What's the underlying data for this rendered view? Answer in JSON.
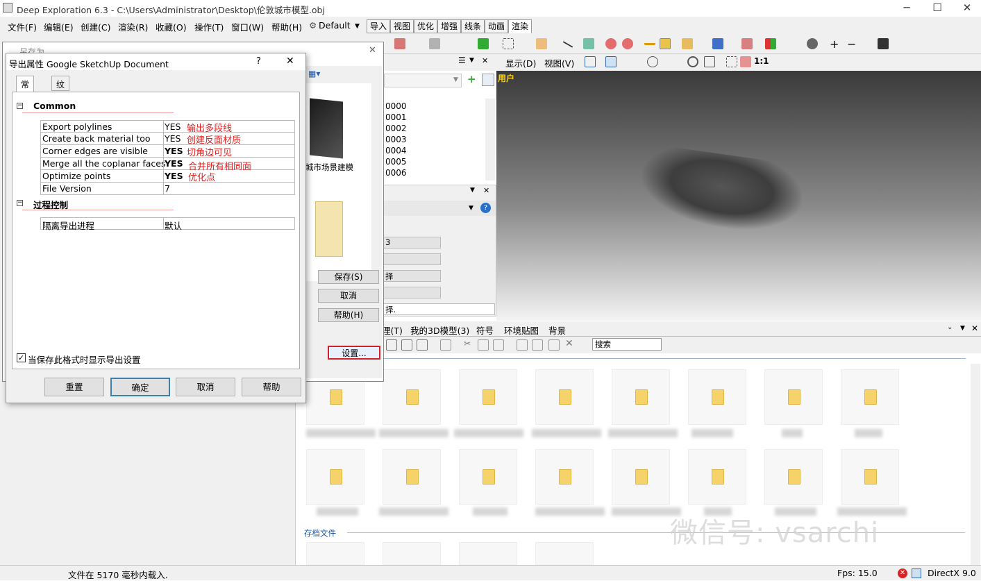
{
  "app": {
    "title": "Deep Exploration 6.3 - C:\\Users\\Administrator\\Desktop\\伦敦城市模型.obj"
  },
  "menu": [
    "文件(F)",
    "编辑(E)",
    "创建(C)",
    "渲染(R)",
    "收藏(O)",
    "操作(T)",
    "窗口(W)",
    "帮助(H)"
  ],
  "preset": "Default",
  "tabs": [
    "导入",
    "视图",
    "优化",
    "增强",
    "线条",
    "动画",
    "渲染"
  ],
  "active_tab": "渲染",
  "view_toolbar": {
    "display": "显示(D)",
    "view": "视图(V)",
    "ratio": "1:1"
  },
  "viewport": {
    "label": "用户"
  },
  "tree_items": [
    "0000",
    "0001",
    "0002",
    "0003",
    "0004",
    "0005",
    "0006"
  ],
  "prop_rows": [
    "3",
    "",
    "择",
    "",
    "择."
  ],
  "browser": {
    "tabs": [
      "理(T)",
      "我的3D模型(3)",
      "符号",
      "环境贴图",
      "背景"
    ],
    "search": "搜索",
    "archive_label": "存档文件"
  },
  "save_dialog": {
    "title": "另存为",
    "folder_label": "城市场景建模",
    "buttons": {
      "save": "保存(S)",
      "cancel": "取消",
      "help": "帮助(H)",
      "settings": "设置..."
    }
  },
  "export_dialog": {
    "title": "导出属性 Google SketchUp Document",
    "help": "?",
    "close": "✕",
    "tabs": [
      "常规",
      "纹理贴图"
    ],
    "sections": [
      {
        "name": "Common",
        "rows": [
          {
            "key": "Export polylines",
            "value": "YES",
            "note": "输出多段线",
            "bold": false
          },
          {
            "key": "Create back material too",
            "value": "YES",
            "note": "创建反面材质",
            "bold": false
          },
          {
            "key": "Corner edges are visible",
            "value": "YES",
            "note": "切角边可见",
            "bold": true
          },
          {
            "key": "Merge all the coplanar faces",
            "value": "YES",
            "note": "合并所有相同面",
            "bold": true
          },
          {
            "key": "Optimize points",
            "value": "YES",
            "note": "优化点",
            "bold": true
          },
          {
            "key": "File Version",
            "value": "7",
            "note": "",
            "bold": false
          }
        ]
      },
      {
        "name": "过程控制",
        "rows": [
          {
            "key": "隔离导出进程",
            "value": "默认",
            "note": "",
            "bold": false
          }
        ]
      }
    ],
    "checkbox_label": "当保存此格式时显示导出设置",
    "checkbox_checked": true,
    "buttons": [
      "重置",
      "确定",
      "取消",
      "帮助"
    ]
  },
  "status": {
    "message": "文件在 5170 毫秒内载入.",
    "fps": "Fps: 15.0",
    "renderer": "DirectX 9.0"
  },
  "watermark": "微信号: vsarchi",
  "colors": {
    "annotation": "#e02020",
    "highlight_border": "#d0202a",
    "viewport_label": "#ffd200",
    "folder": "#f5d26a"
  }
}
